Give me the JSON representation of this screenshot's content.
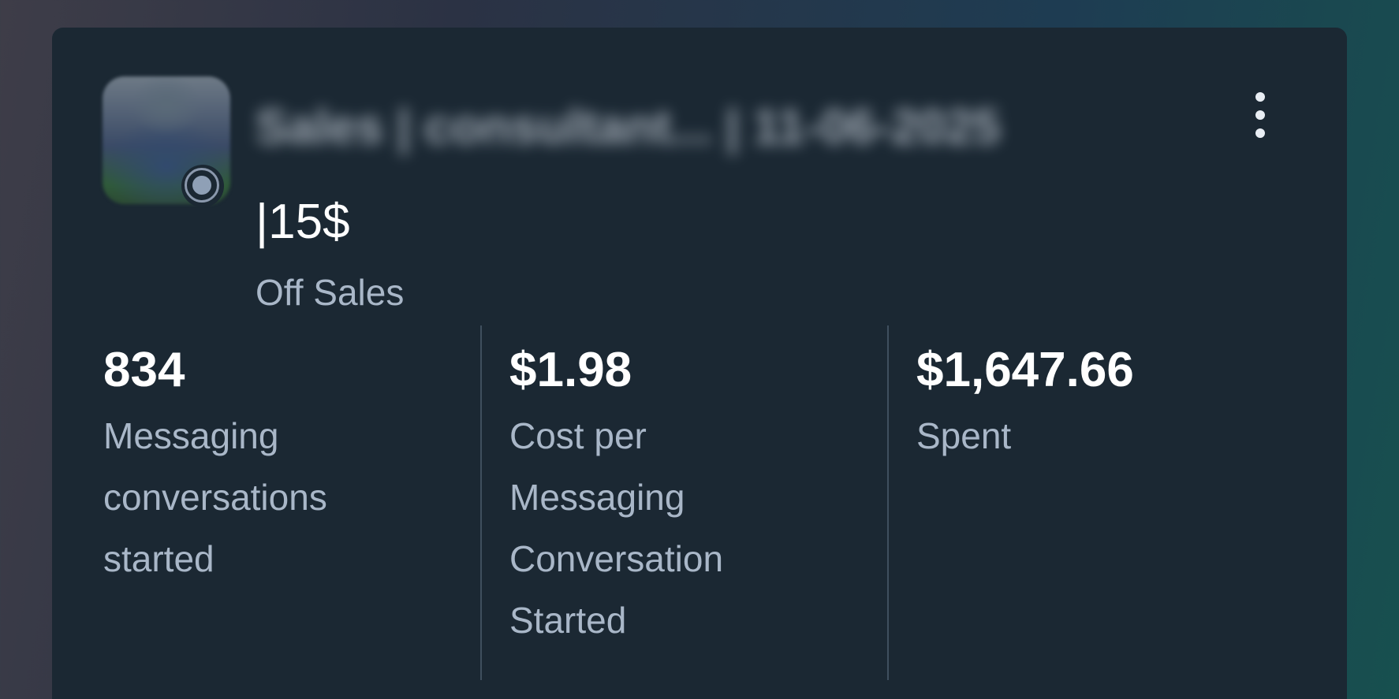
{
  "card": {
    "campaign_name": "Sales | consultant... | 11-06-2025",
    "campaign_subtitle": "|15$",
    "status": "Off Sales",
    "more_icon": "more-vertical-icon",
    "avatar_icon": "campaign-avatar",
    "status_indicator_icon": "status-dot-icon"
  },
  "metrics": [
    {
      "value": "834",
      "label": "Messaging conversations started"
    },
    {
      "value": "$1.98",
      "label": "Cost per Messaging Conversation Started"
    },
    {
      "value": "$1,647.66",
      "label": "Spent"
    }
  ],
  "colors": {
    "card_background": "#1b2833",
    "value_text": "#ffffff",
    "label_text": "#a9b7c8",
    "divider": "#3f4f5e"
  }
}
